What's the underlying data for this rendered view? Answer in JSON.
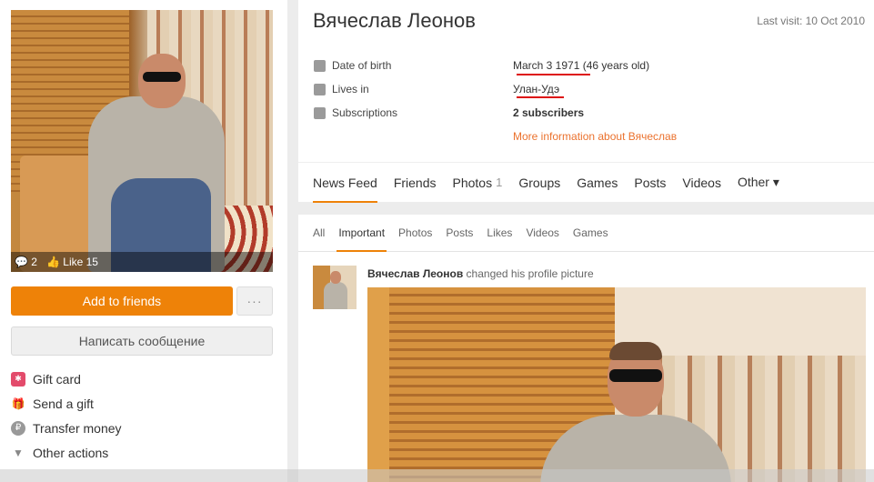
{
  "profile": {
    "name": "Вячеслав Леонов",
    "last_visit": "Last visit: 10 Oct 2010",
    "avatar_stats": {
      "comments": "2",
      "likes": "Like 15"
    }
  },
  "left_panel": {
    "add_friend_label": "Add to friends",
    "more_label": "···",
    "message_label": "Написать сообщение",
    "actions": [
      {
        "icon": "gift-card-icon",
        "label": "Gift card"
      },
      {
        "icon": "gift-icon",
        "label": "Send a gift"
      },
      {
        "icon": "ruble-coin-icon",
        "label": "Transfer money"
      },
      {
        "icon": "triangle-down-icon",
        "label": "Other actions"
      }
    ]
  },
  "info": {
    "rows": [
      {
        "icon": "calendar-icon",
        "label": "Date of birth",
        "value": "March 3 1971 (46 years old)"
      },
      {
        "icon": "city-icon",
        "label": "Lives in",
        "value": "Улан-Удэ"
      },
      {
        "icon": "rss-icon",
        "label": "Subscriptions",
        "value": "2 subscribers"
      }
    ],
    "more_info": "More information about Вячеслав",
    "annotation_color": "#dd1111"
  },
  "tabs": [
    {
      "label": "News Feed",
      "count": ""
    },
    {
      "label": "Friends",
      "count": ""
    },
    {
      "label": "Photos",
      "count": "1"
    },
    {
      "label": "Groups",
      "count": ""
    },
    {
      "label": "Games",
      "count": ""
    },
    {
      "label": "Posts",
      "count": ""
    },
    {
      "label": "Videos",
      "count": ""
    },
    {
      "label": "Other ▾",
      "count": ""
    }
  ],
  "feed": {
    "subtabs": [
      "All",
      "Important",
      "Photos",
      "Posts",
      "Likes",
      "Videos",
      "Games"
    ],
    "active_subtab": "Important",
    "post": {
      "author": "Вячеслав Леонов",
      "action": " changed his profile picture"
    }
  },
  "colors": {
    "accent": "#ee8208",
    "link": "#eb722e"
  }
}
